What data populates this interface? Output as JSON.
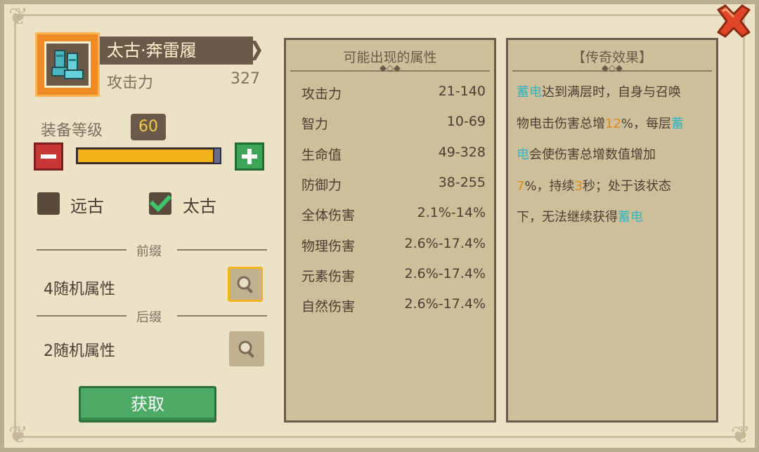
{
  "item": {
    "name": "太古·奔雷履",
    "icon": "boots-icon",
    "stat_label": "攻击力",
    "stat_value": "327"
  },
  "level": {
    "label": "装备等级",
    "value": "60",
    "progress": 1.0
  },
  "options": [
    {
      "label": "远古",
      "checked": false
    },
    {
      "label": "太古",
      "checked": true
    }
  ],
  "prefix": {
    "title": "前缀",
    "text": "4随机属性"
  },
  "suffix": {
    "title": "后缀",
    "text": "2随机属性"
  },
  "acquire_label": "获取",
  "attributes_panel": {
    "title": "可能出现的属性",
    "ornament": "◆◇◆",
    "rows": [
      {
        "name": "攻击力",
        "value": "21-140"
      },
      {
        "name": "智力",
        "value": "10-69"
      },
      {
        "name": "生命值",
        "value": "49-328"
      },
      {
        "name": "防御力",
        "value": "38-255"
      },
      {
        "name": "全体伤害",
        "value": "2.1%-14%"
      },
      {
        "name": "物理伤害",
        "value": "2.6%-17.4%"
      },
      {
        "name": "元素伤害",
        "value": "2.6%-17.4%"
      },
      {
        "name": "自然伤害",
        "value": "2.6%-17.4%"
      }
    ]
  },
  "legend_panel": {
    "title": "【传奇效果】",
    "ornament": "◆◇◆",
    "lines": [
      [
        {
          "t": "蓄电",
          "c": "cyan"
        },
        {
          "t": "达到满层时，自身与召唤",
          "c": ""
        }
      ],
      [
        {
          "t": "物电击伤害总增",
          "c": ""
        },
        {
          "t": "12",
          "c": "orange"
        },
        {
          "t": "%，每层",
          "c": ""
        },
        {
          "t": "蓄",
          "c": "cyan"
        }
      ],
      [
        {
          "t": "电",
          "c": "cyan"
        },
        {
          "t": "会使伤害总增数值增加",
          "c": ""
        }
      ],
      [
        {
          "t": "7",
          "c": "orange"
        },
        {
          "t": "%，持续",
          "c": ""
        },
        {
          "t": "3",
          "c": "orange"
        },
        {
          "t": "秒；处于该状态",
          "c": ""
        }
      ],
      [
        {
          "t": "下，无法继续获得",
          "c": ""
        },
        {
          "t": "蓄电",
          "c": "cyan"
        }
      ]
    ]
  },
  "colors": {
    "accent_cyan": "#35b7c2",
    "accent_orange": "#e08b1a",
    "button_green": "#4caa64",
    "button_red": "#c93636",
    "close_red": "#e0452a"
  }
}
